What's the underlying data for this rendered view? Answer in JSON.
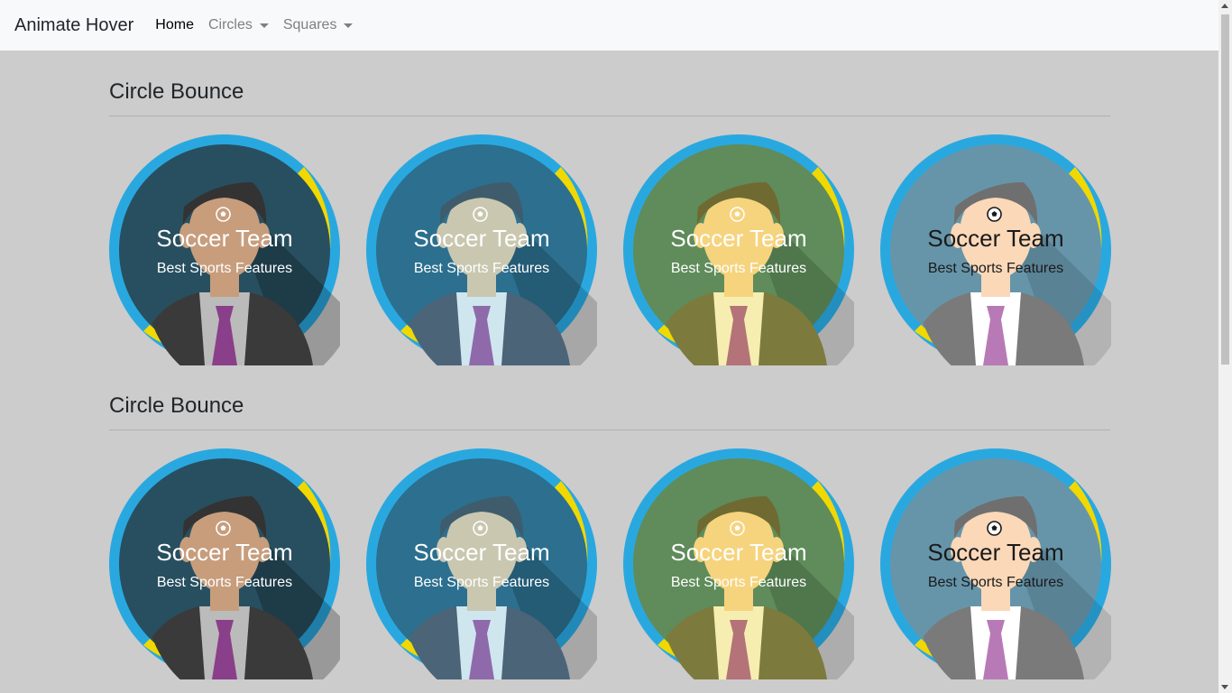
{
  "navbar": {
    "brand": "Animate Hover",
    "links": [
      {
        "label": "Home"
      },
      {
        "label": "Circles"
      },
      {
        "label": "Squares"
      }
    ]
  },
  "sections": [
    {
      "heading": "Circle Bounce"
    },
    {
      "heading": "Circle Bounce"
    }
  ],
  "card": {
    "title": "Soccer Team",
    "subtitle": "Best Sports Features"
  },
  "colors": {
    "ring_blue": "#29a8e0",
    "ring_yellow": "#f0d800",
    "card1_bg": "#284f60",
    "card2_bg": "#2c6f8f",
    "card3_bg": "#5f8c5a",
    "card4_bg": "#6695aa"
  }
}
